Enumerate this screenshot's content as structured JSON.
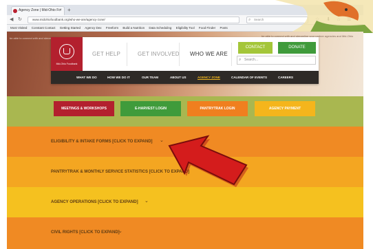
{
  "browser": {
    "tab_title": "Agency Zone | Mid-Ohio Fo",
    "tab_close": "×",
    "new_tab": "+",
    "url": "www.midohiofoodbank.org/who-we-are/agency-zone/",
    "search_placeholder": "Search",
    "nav_back": "◀",
    "nav_reload": "↻",
    "toolbar_icons": "☆ ⬇ ⌂ ☰",
    "bookmarks": [
      "Most Visited",
      "Constant Contact",
      "Getting Started",
      "Agency Dex",
      "Freeform",
      "Build a Nutrition",
      "Data Scheduling",
      "Eligibility Tool",
      "Food Finder",
      "Posts"
    ]
  },
  "hero": {
    "left_text": "be able to connect with and streamline relationships between partner agencies and Mid-Ohio Food...",
    "right_text": "be able to connect with and streamline your partner agencies and Mid-Ohio Food..."
  },
  "header": {
    "logo_text": "Mid-Ohio Foodbank",
    "main_nav": [
      {
        "label": "GET HELP"
      },
      {
        "label": "GET INVOLVED"
      },
      {
        "label": "WHO WE ARE"
      }
    ],
    "contact_label": "CONTACT",
    "donate_label": "DONATE",
    "search_placeholder": "Search...",
    "sub_nav": [
      {
        "label": "WHAT WE DO"
      },
      {
        "label": "HOW WE DO IT"
      },
      {
        "label": "OUR TEAM"
      },
      {
        "label": "ABOUT US"
      },
      {
        "label": "AGENCY ZONE"
      },
      {
        "label": "CALENDAR OF EVENTS"
      },
      {
        "label": "CAREERS"
      }
    ]
  },
  "quick_buttons": [
    {
      "label": "MEETINGS & WORKSHOPS",
      "color": "#b3202e"
    },
    {
      "label": "E-HARVEST LOGIN",
      "color": "#3f9b3b"
    },
    {
      "label": "PANTRYTRAK LOGIN",
      "color": "#f07f1f"
    },
    {
      "label": "AGENCY PAYMENT",
      "color": "#f5b51c"
    }
  ],
  "accordion": [
    {
      "label": "ELIGIBILITY & INTAKE FORMS [CLICK TO EXPAND]",
      "color": "#f08a23"
    },
    {
      "label": "PANTRYTRAK & MONTHLY SERVICE STATISTICS [CLICK TO EXPAND]",
      "color": "#f4a621"
    },
    {
      "label": "AGENCY OPERATIONS [CLICK TO EXPAND]",
      "color": "#f5c11f"
    },
    {
      "label": "CIVIL RIGHTS [CLICK TO EXPAND]",
      "color": "#f08a23"
    }
  ],
  "chevron": "⌄",
  "colors": {
    "arrow_red": "#d41c1c",
    "active_underline": "#8cb53c",
    "subnav_bg": "#2e2a27",
    "green_band": "#a9b750"
  }
}
